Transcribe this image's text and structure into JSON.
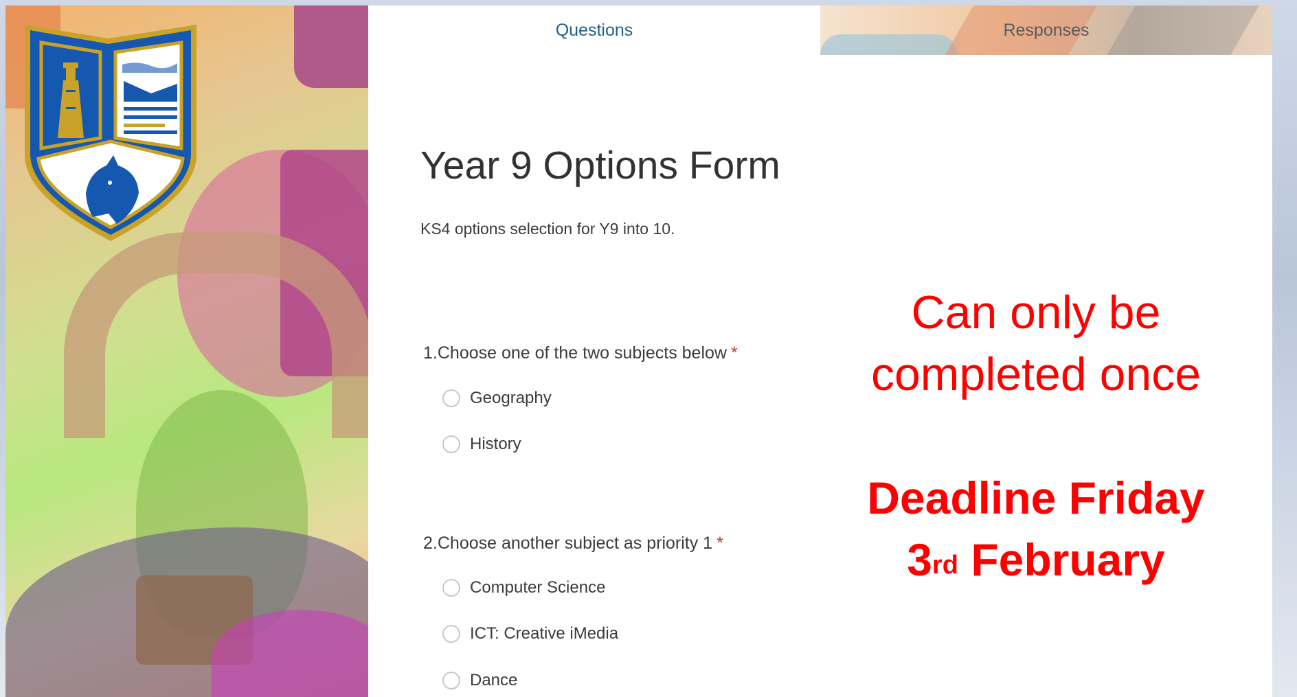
{
  "tabs": {
    "questions": "Questions",
    "responses": "Responses"
  },
  "form": {
    "title": "Year 9 Options Form",
    "description": "KS4 options selection for Y9 into 10."
  },
  "questions": [
    {
      "number": "1.",
      "text": "Choose one of the two subjects below",
      "required_mark": "*",
      "options": [
        "Geography",
        "History"
      ]
    },
    {
      "number": "2.",
      "text": "Choose another subject as priority 1",
      "required_mark": "*",
      "options": [
        "Computer Science",
        "ICT: Creative iMedia",
        "Dance"
      ]
    }
  ],
  "notice": {
    "line1": "Can only be",
    "line2": "completed once",
    "deadline_line1": "Deadline Friday",
    "deadline_day": "3",
    "deadline_suffix": "rd",
    "deadline_month": "February"
  },
  "colors": {
    "notice": "#ff0000",
    "tab_active": "#1f5f8b",
    "crest_blue": "#1458b0",
    "crest_gold": "#c9a227"
  },
  "icons": {
    "crest": "school-crest-lighthouse-wolf"
  }
}
